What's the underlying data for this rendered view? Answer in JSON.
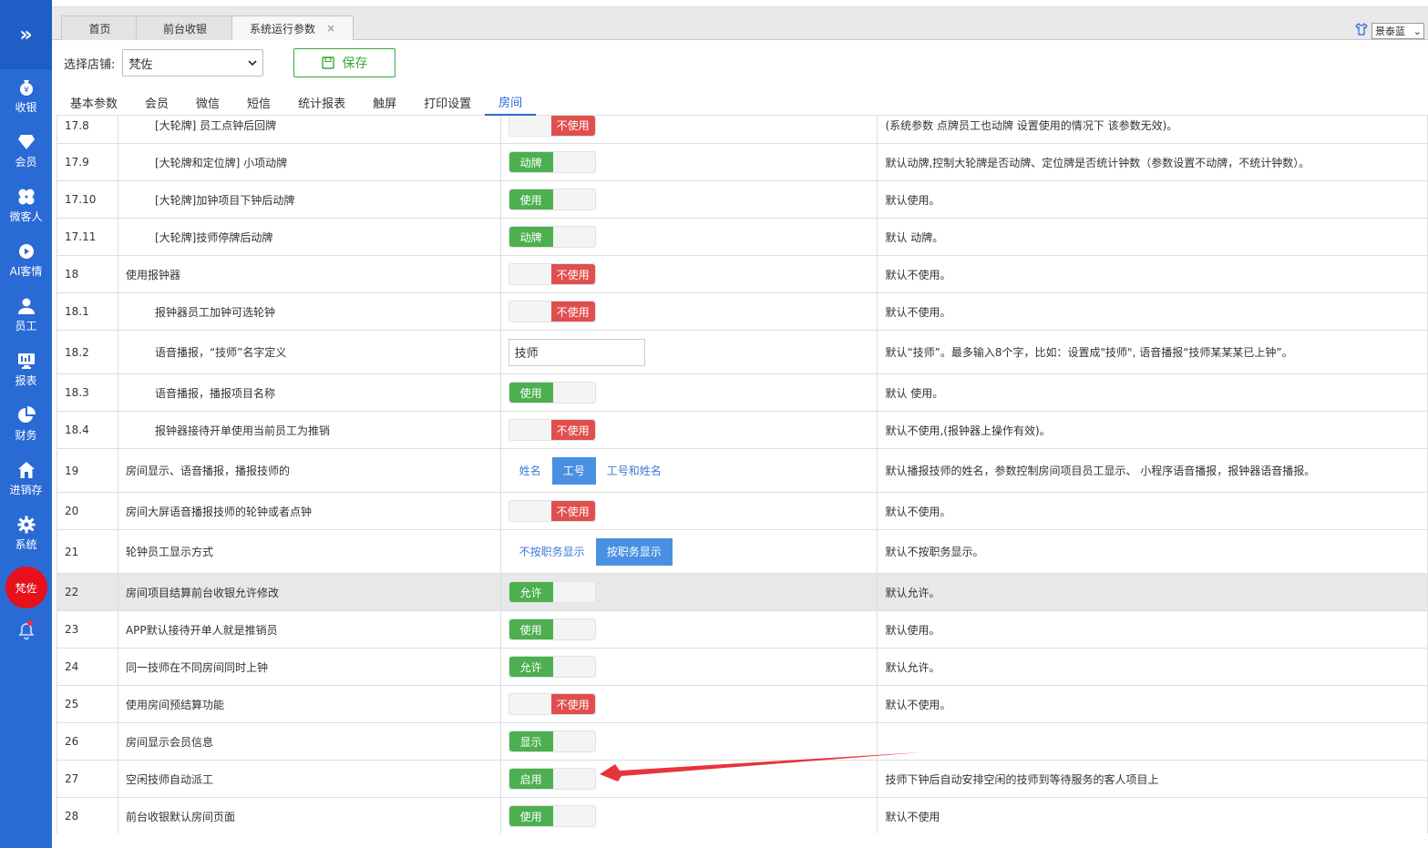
{
  "sidebar": {
    "items": [
      {
        "label": "收银",
        "icon": "yen-bag-icon"
      },
      {
        "label": "会员",
        "icon": "diamond-icon"
      },
      {
        "label": "微客人",
        "icon": "clover-icon"
      },
      {
        "label": "AI客情",
        "icon": "play-circle-icon"
      },
      {
        "label": "员工",
        "icon": "person-icon"
      },
      {
        "label": "报表",
        "icon": "monitor-icon"
      },
      {
        "label": "财务",
        "icon": "pie-icon"
      },
      {
        "label": "进销存",
        "icon": "house-icon"
      },
      {
        "label": "系统",
        "icon": "gear-icon"
      }
    ],
    "avatar": "梵佐"
  },
  "tabs": {
    "home": "首页",
    "cashier": "前台收银",
    "params": "系统运行参数",
    "close": "×"
  },
  "theme": {
    "value": "景泰蓝"
  },
  "toolbar": {
    "store_label": "选择店铺:",
    "store_value": "梵佐",
    "save_label": "保存"
  },
  "section_tabs": [
    "基本参数",
    "会员",
    "微信",
    "短信",
    "统计报表",
    "触屏",
    "打印设置",
    "房间"
  ],
  "rows": [
    {
      "no": "17.8",
      "name": "[大轮牌] 员工点钟后回牌",
      "ctl": "switch-off",
      "label": "不使用",
      "desc": "(系统参数 点牌员工也动牌 设置使用的情况下 该参数无效)。",
      "indent": true
    },
    {
      "no": "17.9",
      "name": "[大轮牌和定位牌] 小项动牌",
      "ctl": "switch-on",
      "label": "动牌",
      "desc": "默认动牌,控制大轮牌是否动牌、定位牌是否统计钟数（参数设置不动牌，不统计钟数）。",
      "indent": true
    },
    {
      "no": "17.10",
      "name": "[大轮牌]加钟项目下钟后动牌",
      "ctl": "switch-on",
      "label": "使用",
      "desc": "默认使用。",
      "indent": true
    },
    {
      "no": "17.11",
      "name": "[大轮牌]技师停牌后动牌",
      "ctl": "switch-on",
      "label": "动牌",
      "desc": "默认 动牌。",
      "indent": true
    },
    {
      "no": "18",
      "name": "使用报钟器",
      "ctl": "switch-off",
      "label": "不使用",
      "desc": "默认不使用。",
      "indent": false
    },
    {
      "no": "18.1",
      "name": "报钟器员工加钟可选轮钟",
      "ctl": "switch-off",
      "label": "不使用",
      "desc": "默认不使用。",
      "indent": true
    },
    {
      "no": "18.2",
      "name": "语音播报，“技师”名字定义",
      "ctl": "input",
      "label": "技师",
      "desc": "默认“技师”。最多输入8个字，比如：设置成\"技师\", 语音播报“技师某某某已上钟”。",
      "indent": true
    },
    {
      "no": "18.3",
      "name": "语音播报，播报项目名称",
      "ctl": "switch-on",
      "label": "使用",
      "desc": "默认 使用。",
      "indent": true
    },
    {
      "no": "18.4",
      "name": "报钟器接待开单使用当前员工为推销",
      "ctl": "switch-off",
      "label": "不使用",
      "desc": "默认不使用,(报钟器上操作有效)。",
      "indent": true
    },
    {
      "no": "19",
      "name": "房间显示、语音播报，播报技师的",
      "ctl": "options3",
      "opts": [
        "姓名",
        "工号",
        "工号和姓名"
      ],
      "sel": 1,
      "desc": "默认播报技师的姓名，参数控制房间项目员工显示、 小程序语音播报，报钟器语音播报。",
      "indent": false
    },
    {
      "no": "20",
      "name": "房间大屏语音播报技师的轮钟或者点钟",
      "ctl": "switch-off",
      "label": "不使用",
      "desc": "默认不使用。",
      "indent": false
    },
    {
      "no": "21",
      "name": "轮钟员工显示方式",
      "ctl": "options2",
      "opts": [
        "不按职务显示",
        "按职务显示"
      ],
      "sel": 1,
      "desc": "默认不按职务显示。",
      "indent": false
    },
    {
      "no": "22",
      "name": "房间项目结算前台收银允许修改",
      "ctl": "switch-on",
      "label": "允许",
      "desc": "默认允许。",
      "indent": false,
      "hl": true
    },
    {
      "no": "23",
      "name": "APP默认接待开单人就是推销员",
      "ctl": "switch-on",
      "label": "使用",
      "desc": "默认使用。",
      "indent": false
    },
    {
      "no": "24",
      "name": "同一技师在不同房间同时上钟",
      "ctl": "switch-on",
      "label": "允许",
      "desc": "默认允许。",
      "indent": false
    },
    {
      "no": "25",
      "name": "使用房间预结算功能",
      "ctl": "switch-off",
      "label": "不使用",
      "desc": "默认不使用。",
      "indent": false
    },
    {
      "no": "26",
      "name": "房间显示会员信息",
      "ctl": "switch-on",
      "label": "显示",
      "desc": "",
      "indent": false
    },
    {
      "no": "27",
      "name": "空闲技师自动派工",
      "ctl": "switch-on",
      "label": "启用",
      "desc": "技师下钟后自动安排空闲的技师到等待服务的客人项目上",
      "indent": false
    },
    {
      "no": "28",
      "name": "前台收银默认房间页面",
      "ctl": "switch-on",
      "label": "使用",
      "desc": "默认不使用",
      "indent": false
    }
  ],
  "colors": {
    "sidebar": "#2a6ad4",
    "on": "#4caf50",
    "off": "#e14e4e",
    "accent": "#4a90e2",
    "arrow": "#e8333a"
  }
}
